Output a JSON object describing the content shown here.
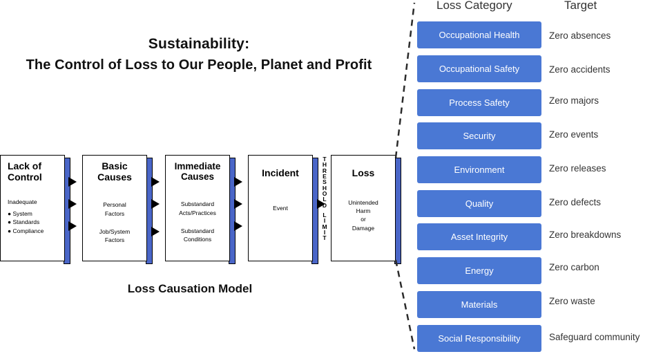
{
  "title": {
    "line1": "Sustainability:",
    "line2": "The Control of Loss to Our People, Planet and Profit"
  },
  "model": {
    "caption": "Loss Causation Model",
    "threshold_label": "THRESHOLD LIMIT",
    "boxes": [
      {
        "heading": "Lack of\nControl",
        "heading_line1": "Lack of",
        "heading_line2": "Control",
        "body_line1": "Inadequate",
        "bullets": [
          "System",
          "Standards",
          "Compliance"
        ]
      },
      {
        "heading_line1": "Basic",
        "heading_line2": "Causes",
        "body_line1": "Personal",
        "body_line2": "Factors",
        "body_line3": "Job/System",
        "body_line4": "Factors"
      },
      {
        "heading_line1": "Immediate",
        "heading_line2": "Causes",
        "body_line1": "Substandard",
        "body_line2": "Acts/Practices",
        "body_line3": "Substandard",
        "body_line4": "Conditions"
      },
      {
        "heading_line1": "Incident",
        "heading_line2": "",
        "body_line1": "Event"
      },
      {
        "heading_line1": "Loss",
        "heading_line2": "",
        "body_line1": "Unintended",
        "body_line2": "Harm",
        "body_line3": "or",
        "body_line4": "Damage"
      }
    ]
  },
  "table": {
    "headers": {
      "category": "Loss Category",
      "target": "Target"
    },
    "rows": [
      {
        "category": "Occupational Health",
        "target": "Zero absences"
      },
      {
        "category": "Occupational Safety",
        "target": "Zero accidents"
      },
      {
        "category": "Process Safety",
        "target": "Zero majors"
      },
      {
        "category": "Security",
        "target": "Zero events"
      },
      {
        "category": "Environment",
        "target": "Zero releases"
      },
      {
        "category": "Quality",
        "target": "Zero defects"
      },
      {
        "category": "Asset Integrity",
        "target": "Zero breakdowns"
      },
      {
        "category": "Energy",
        "target": "Zero carbon"
      },
      {
        "category": "Materials",
        "target": "Zero waste"
      },
      {
        "category": "Social Responsibility",
        "target": "Safeguard community"
      }
    ]
  },
  "colors": {
    "chip": "#4a78d4",
    "shadow": "#4a66c8",
    "text_dark": "#333333"
  }
}
